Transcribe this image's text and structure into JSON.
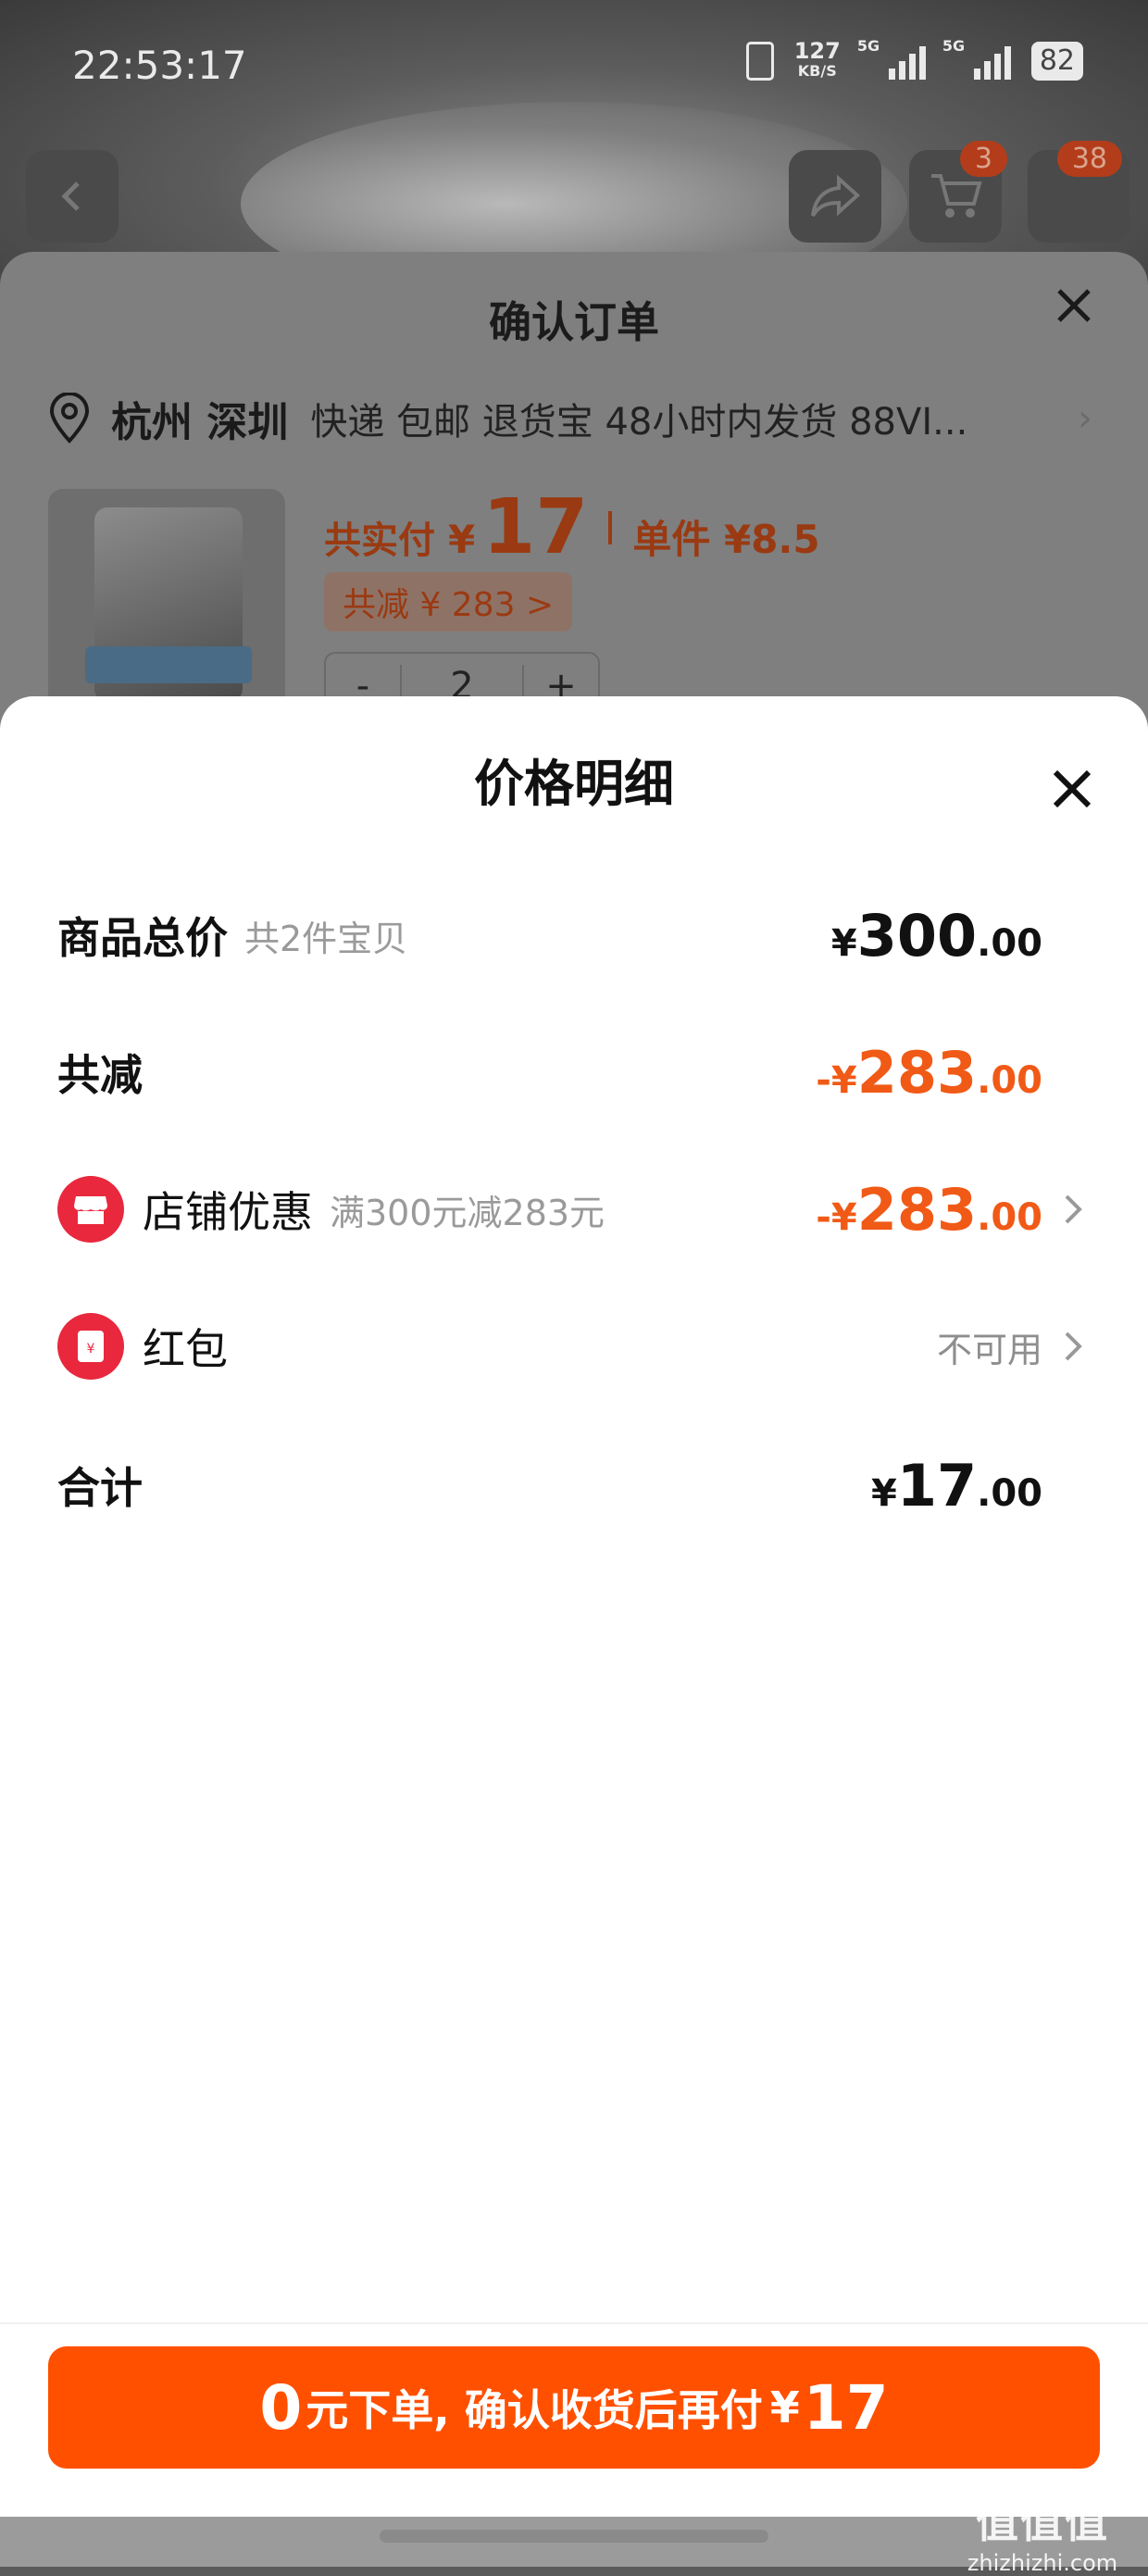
{
  "status_bar": {
    "time": "22:53:17",
    "net_speed": "127",
    "net_unit": "KB/S",
    "sim1": "5G",
    "sim2": "5G",
    "battery": "82"
  },
  "product_page": {
    "cart_badge": "3",
    "message_badge": "38",
    "icons": [
      "back-icon",
      "share-icon",
      "cart-icon"
    ]
  },
  "order_sheet": {
    "title": "确认订单",
    "address_city": "杭州 深圳",
    "address_desc": "快递 包邮 退货宝 48小时内发货 88VI...",
    "pay_label": "共实付",
    "pay_currency": "¥",
    "pay_amount": "17",
    "unit_price": "单件 ¥8.5",
    "total_reduce": "共减 ¥ 283 >",
    "stepper_minus": "-",
    "quantity": "2",
    "stepper_plus": "+"
  },
  "price_detail": {
    "title": "价格明细",
    "rows": [
      {
        "name": "商品总价",
        "sub": "共2件宝贝",
        "currency": "¥",
        "int": "300",
        "dec": ".00"
      },
      {
        "name": "共减",
        "sign": "-",
        "currency": "¥",
        "int": "283",
        "dec": ".00"
      },
      {
        "name": "店铺优惠",
        "sub": "满300元减283元",
        "sign": "-",
        "currency": "¥",
        "int": "283",
        "dec": ".00",
        "icon": "store-icon"
      },
      {
        "name": "红包",
        "value": "不可用",
        "icon": "red-packet-icon"
      },
      {
        "name": "合计",
        "currency": "¥",
        "int": "17",
        "dec": ".00"
      }
    ],
    "colors": {
      "accent": "#ff5000",
      "discount": "#f05a16",
      "icon_red": "#e9283d"
    }
  },
  "cta": {
    "zero": "0",
    "text": "元下单, 确认收货后再付",
    "currency": "¥",
    "amount": "17"
  },
  "watermark": {
    "logo": "值值值",
    "site": "zhizhizhi.com"
  }
}
